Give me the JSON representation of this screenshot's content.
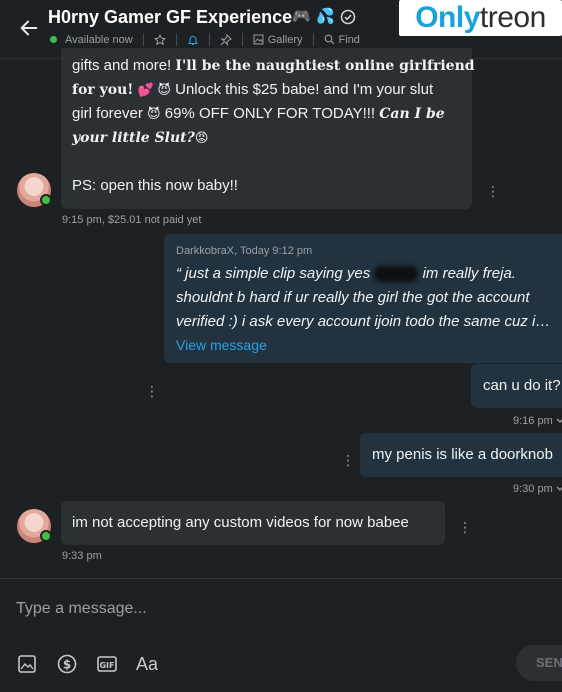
{
  "header": {
    "title": "H0rny Gamer GF Experience",
    "title_icons": [
      "gamepad-icon",
      "sweat-droplets-icon",
      "verified-icon"
    ],
    "status": "Available now",
    "gallery_label": "Gallery",
    "find_label": "Find"
  },
  "watermark": {
    "part1": "Only",
    "part2": "treon"
  },
  "messages": {
    "m1": {
      "line1a": "gifts and more!",
      "line1b": "I'll be the naughtiest online girlfriend",
      "line2a": "for you!",
      "line2b": "💕 😈",
      "line2c": "Unlock this $25 babe! and I'm your slut",
      "line3a": "girl forever",
      "line3b": "😈",
      "line3c": "69% OFF ONLY FOR TODAY!!!",
      "line3d": "Can I be",
      "line4a": "your little Slut?",
      "line4b": "😡",
      "ps": "PS: open this now baby!!",
      "time": "9:15 pm",
      "price": "$25.01 not paid yet"
    },
    "m2": {
      "quote_author": "DarkkobraX, Today 9:12 pm",
      "quote_l1a": "“ just a simple clip saying yes",
      "quote_l1b": "im really freja.",
      "quote_l2": "shouldnt b hard if ur really the girl the got the account",
      "quote_l3": "verified :) i ask every account ijoin todo the same cuz i…",
      "view_link": "View message"
    },
    "m3": {
      "text": "can u do it?",
      "time": "9:16 pm"
    },
    "m4": {
      "text": "my penis is like a doorknob",
      "time": "9:30 pm"
    },
    "m5": {
      "text": "im not accepting any custom videos for now babee",
      "time": "9:33 pm"
    }
  },
  "composer": {
    "placeholder": "Type a message...",
    "tools": [
      "image-icon",
      "dollar-icon",
      "gif-icon",
      "text-format-icon"
    ],
    "text_tool_label": "Aa",
    "gif_label": "GIF",
    "send_label": "SEND"
  },
  "colors": {
    "background": "#1e2124",
    "incoming_bubble": "#2b3034",
    "outgoing_bubble": "#22323e",
    "accent": "#27a2e5",
    "online": "#3fbf4a"
  }
}
